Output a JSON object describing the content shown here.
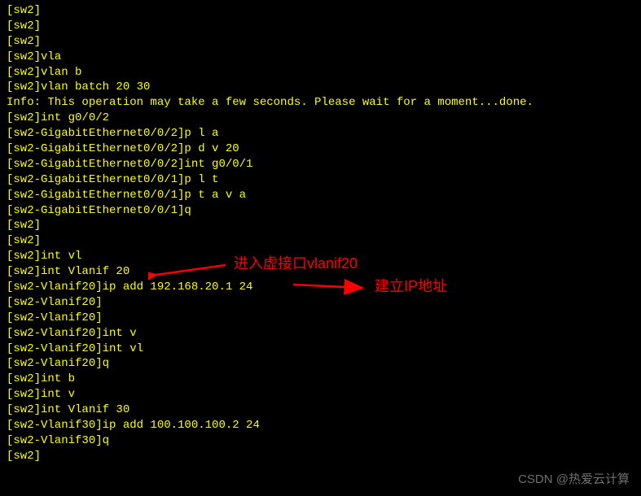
{
  "lines": [
    "[sw2]",
    "[sw2]",
    "[sw2]",
    "[sw2]vla",
    "[sw2]vlan b",
    "[sw2]vlan batch 20 30",
    "Info: This operation may take a few seconds. Please wait for a moment...done.",
    "[sw2]int g0/0/2",
    "[sw2-GigabitEthernet0/0/2]p l a",
    "[sw2-GigabitEthernet0/0/2]p d v 20",
    "[sw2-GigabitEthernet0/0/2]int g0/0/1",
    "[sw2-GigabitEthernet0/0/1]p l t",
    "[sw2-GigabitEthernet0/0/1]p t a v a",
    "[sw2-GigabitEthernet0/0/1]q",
    "[sw2]",
    "[sw2]",
    "[sw2]int vl",
    "[sw2]int Vlanif 20",
    "[sw2-Vlanif20]ip add 192.168.20.1 24",
    "[sw2-Vlanif20]",
    "[sw2-Vlanif20]",
    "[sw2-Vlanif20]int v",
    "[sw2-Vlanif20]int vl",
    "[sw2-Vlanif20]q",
    "[sw2]int b",
    "[sw2]int v",
    "[sw2]int Vlanif 30",
    "[sw2-Vlanif30]ip add 100.100.100.2 24",
    "[sw2-Vlanif30]q",
    "[sw2]"
  ],
  "annotations": {
    "enter_vlanif": "进入虚接口vlanif20",
    "set_ip": "建立IP地址"
  },
  "watermark": "CSDN @热爱云计算"
}
